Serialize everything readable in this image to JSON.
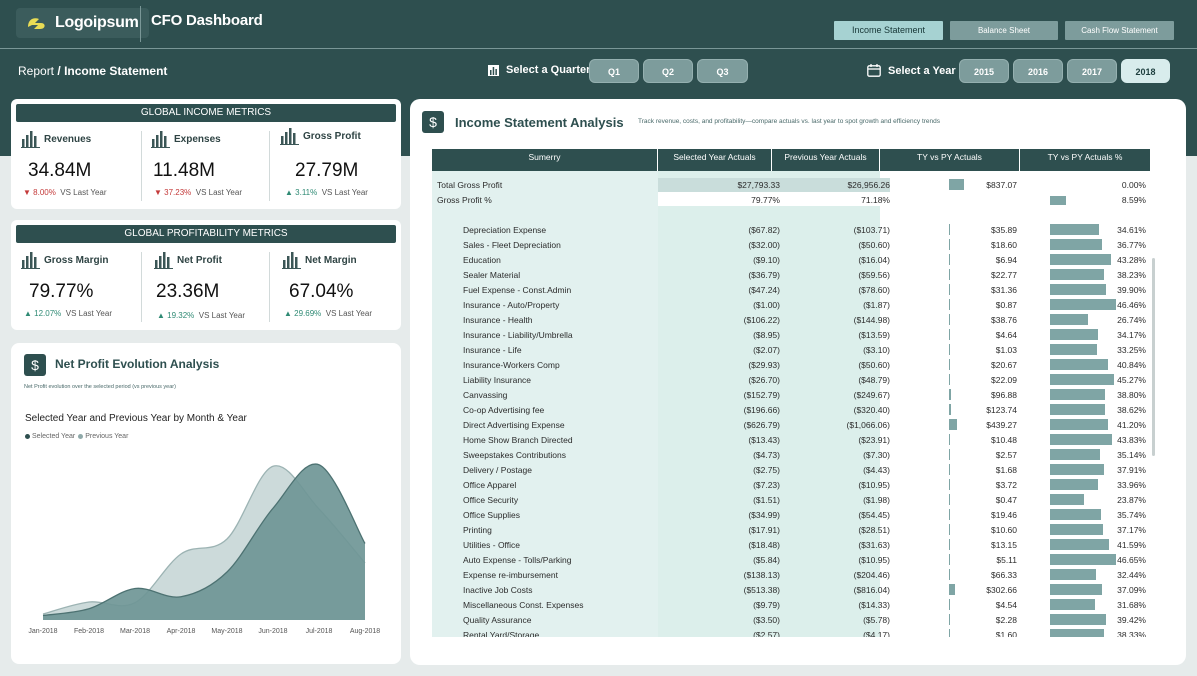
{
  "app": {
    "logo_text": "Logoipsum",
    "title": "CFO Dashboard"
  },
  "nav_tabs": [
    {
      "label": "Income Statement",
      "active": true
    },
    {
      "label": "Balance Sheet",
      "active": false
    },
    {
      "label": "Cash Flow Statement",
      "active": false
    }
  ],
  "breadcrumb": {
    "root": "Report",
    "separator": "/",
    "current": "Income Statement"
  },
  "quarter_filter": {
    "label": "Select a Quarter",
    "options": [
      "Q1",
      "Q2",
      "Q3"
    ]
  },
  "year_filter": {
    "label": "Select a Year",
    "options": [
      "2015",
      "2016",
      "2017",
      "2018"
    ],
    "selected": "2018"
  },
  "income_metrics": {
    "title": "GLOBAL INCOME METRICS",
    "items": [
      {
        "name": "Revenues",
        "value": "34.84M",
        "direction": "down",
        "delta": "8.00%",
        "compare": "VS Last Year"
      },
      {
        "name": "Expenses",
        "value": "11.48M",
        "direction": "down",
        "delta": "37.23%",
        "compare": "VS Last Year"
      },
      {
        "name": "Gross Profit",
        "value": "27.79M",
        "direction": "up",
        "delta": "3.11%",
        "compare": "VS Last Year"
      }
    ]
  },
  "profit_metrics": {
    "title": "GLOBAL PROFITABILITY METRICS",
    "items": [
      {
        "name": "Gross Margin",
        "value": "79.77%",
        "direction": "up",
        "delta": "12.07%",
        "compare": "VS Last Year"
      },
      {
        "name": "Net Profit",
        "value": "23.36M",
        "direction": "up",
        "delta": "19.32%",
        "compare": "VS Last Year"
      },
      {
        "name": "Net Margin",
        "value": "67.04%",
        "direction": "up",
        "delta": "29.69%",
        "compare": "VS Last Year"
      }
    ]
  },
  "net_profit": {
    "badge": "$",
    "title": "Net Profit Evolution Analysis",
    "subtitle": "Net Profit evolution over the selected period (vs previous year)",
    "chart_title": "Selected Year and Previous Year by Month & Year",
    "legend": [
      {
        "name": "Selected Year",
        "color": "#6f9696"
      },
      {
        "name": "Previous Year",
        "color": "#a5bcbc"
      }
    ]
  },
  "chart_data": {
    "type": "area",
    "title": "Selected Year and Previous Year by Month & Year",
    "categories": [
      "Jan-2018",
      "Feb-2018",
      "Mar-2018",
      "Apr-2018",
      "May-2018",
      "Jun-2018",
      "Jul-2018",
      "Aug-2018"
    ],
    "series": [
      {
        "name": "Selected Year",
        "values": [
          0.6,
          1.5,
          4.2,
          3.1,
          6.4,
          14.9,
          20.7,
          10.2
        ],
        "color": "#6f9696"
      },
      {
        "name": "Previous Year",
        "values": [
          0.8,
          2.4,
          2.3,
          8.8,
          10.8,
          20.5,
          14.8,
          7.6
        ],
        "color": "#b9cccc"
      }
    ],
    "ylim": [
      0,
      24
    ],
    "grid": false,
    "legend_position": "top-left"
  },
  "income_statement": {
    "badge": "$",
    "title": "Income Statement Analysis",
    "subtitle": "Track revenue, costs, and profitability—compare actuals vs. last year to spot growth and efficiency trends",
    "columns": [
      "Sumerry",
      "Selected Year Actuals",
      "Previous Year Actuals",
      "TY vs PY Actuals",
      "TY vs PY Actuals %"
    ],
    "summary_rows": [
      {
        "label": "Total Gross Profit",
        "ty": "$27,793.33",
        "py": "$26,956.26",
        "diff": "$837.07",
        "pct": "0.00%",
        "diff_val": 837.07,
        "pct_val": 0.0
      },
      {
        "label": "Gross Profit %",
        "ty": "79.77%",
        "py": "71.18%",
        "diff": "",
        "pct": "8.59%",
        "diff_val": 0,
        "pct_val": 8.59
      }
    ],
    "rows": [
      {
        "label": "Depreciation Expense",
        "ty": "($67.82)",
        "py": "($103.71)",
        "diff": "$35.89",
        "pct": "34.61%",
        "diff_val": 35.89,
        "pct_val": 34.61
      },
      {
        "label": "Sales - Fleet Depreciation",
        "ty": "($32.00)",
        "py": "($50.60)",
        "diff": "$18.60",
        "pct": "36.77%",
        "diff_val": 18.6,
        "pct_val": 36.77
      },
      {
        "label": "Education",
        "ty": "($9.10)",
        "py": "($16.04)",
        "diff": "$6.94",
        "pct": "43.28%",
        "diff_val": 6.94,
        "pct_val": 43.28
      },
      {
        "label": "Sealer Material",
        "ty": "($36.79)",
        "py": "($59.56)",
        "diff": "$22.77",
        "pct": "38.23%",
        "diff_val": 22.77,
        "pct_val": 38.23
      },
      {
        "label": "Fuel Expense - Const.Admin",
        "ty": "($47.24)",
        "py": "($78.60)",
        "diff": "$31.36",
        "pct": "39.90%",
        "diff_val": 31.36,
        "pct_val": 39.9
      },
      {
        "label": "Insurance - Auto/Property",
        "ty": "($1.00)",
        "py": "($1.87)",
        "diff": "$0.87",
        "pct": "46.46%",
        "diff_val": 0.87,
        "pct_val": 46.46
      },
      {
        "label": "Insurance - Health",
        "ty": "($106.22)",
        "py": "($144.98)",
        "diff": "$38.76",
        "pct": "26.74%",
        "diff_val": 38.76,
        "pct_val": 26.74
      },
      {
        "label": "Insurance - Liability/Umbrella",
        "ty": "($8.95)",
        "py": "($13.59)",
        "diff": "$4.64",
        "pct": "34.17%",
        "diff_val": 4.64,
        "pct_val": 34.17
      },
      {
        "label": "Insurance - Life",
        "ty": "($2.07)",
        "py": "($3.10)",
        "diff": "$1.03",
        "pct": "33.25%",
        "diff_val": 1.03,
        "pct_val": 33.25
      },
      {
        "label": "Insurance-Workers Comp",
        "ty": "($29.93)",
        "py": "($50.60)",
        "diff": "$20.67",
        "pct": "40.84%",
        "diff_val": 20.67,
        "pct_val": 40.84
      },
      {
        "label": "Liability Insurance",
        "ty": "($26.70)",
        "py": "($48.79)",
        "diff": "$22.09",
        "pct": "45.27%",
        "diff_val": 22.09,
        "pct_val": 45.27
      },
      {
        "label": "Canvassing",
        "ty": "($152.79)",
        "py": "($249.67)",
        "diff": "$96.88",
        "pct": "38.80%",
        "diff_val": 96.88,
        "pct_val": 38.8
      },
      {
        "label": "Co-op Advertising fee",
        "ty": "($196.66)",
        "py": "($320.40)",
        "diff": "$123.74",
        "pct": "38.62%",
        "diff_val": 123.74,
        "pct_val": 38.62
      },
      {
        "label": "Direct Advertising Expense",
        "ty": "($626.79)",
        "py": "($1,066.06)",
        "diff": "$439.27",
        "pct": "41.20%",
        "diff_val": 439.27,
        "pct_val": 41.2
      },
      {
        "label": "Home Show Branch Directed",
        "ty": "($13.43)",
        "py": "($23.91)",
        "diff": "$10.48",
        "pct": "43.83%",
        "diff_val": 10.48,
        "pct_val": 43.83
      },
      {
        "label": "Sweepstakes Contributions",
        "ty": "($4.73)",
        "py": "($7.30)",
        "diff": "$2.57",
        "pct": "35.14%",
        "diff_val": 2.57,
        "pct_val": 35.14
      },
      {
        "label": "Delivery / Postage",
        "ty": "($2.75)",
        "py": "($4.43)",
        "diff": "$1.68",
        "pct": "37.91%",
        "diff_val": 1.68,
        "pct_val": 37.91
      },
      {
        "label": "Office Apparel",
        "ty": "($7.23)",
        "py": "($10.95)",
        "diff": "$3.72",
        "pct": "33.96%",
        "diff_val": 3.72,
        "pct_val": 33.96
      },
      {
        "label": "Office Security",
        "ty": "($1.51)",
        "py": "($1.98)",
        "diff": "$0.47",
        "pct": "23.87%",
        "diff_val": 0.47,
        "pct_val": 23.87
      },
      {
        "label": "Office Supplies",
        "ty": "($34.99)",
        "py": "($54.45)",
        "diff": "$19.46",
        "pct": "35.74%",
        "diff_val": 19.46,
        "pct_val": 35.74
      },
      {
        "label": "Printing",
        "ty": "($17.91)",
        "py": "($28.51)",
        "diff": "$10.60",
        "pct": "37.17%",
        "diff_val": 10.6,
        "pct_val": 37.17
      },
      {
        "label": "Utilities - Office",
        "ty": "($18.48)",
        "py": "($31.63)",
        "diff": "$13.15",
        "pct": "41.59%",
        "diff_val": 13.15,
        "pct_val": 41.59
      },
      {
        "label": "Auto Expense - Tolls/Parking",
        "ty": "($5.84)",
        "py": "($10.95)",
        "diff": "$5.11",
        "pct": "46.65%",
        "diff_val": 5.11,
        "pct_val": 46.65
      },
      {
        "label": "Expense re-imbursement",
        "ty": "($138.13)",
        "py": "($204.46)",
        "diff": "$66.33",
        "pct": "32.44%",
        "diff_val": 66.33,
        "pct_val": 32.44
      },
      {
        "label": "Inactive Job Costs",
        "ty": "($513.38)",
        "py": "($816.04)",
        "diff": "$302.66",
        "pct": "37.09%",
        "diff_val": 302.66,
        "pct_val": 37.09
      },
      {
        "label": "Miscellaneous Const. Expenses",
        "ty": "($9.79)",
        "py": "($14.33)",
        "diff": "$4.54",
        "pct": "31.68%",
        "diff_val": 4.54,
        "pct_val": 31.68
      },
      {
        "label": "Quality Assurance",
        "ty": "($3.50)",
        "py": "($5.78)",
        "diff": "$2.28",
        "pct": "39.42%",
        "diff_val": 2.28,
        "pct_val": 39.42
      },
      {
        "label": "Rental Yard/Storage",
        "ty": "($2.57)",
        "py": "($4.17)",
        "diff": "$1.60",
        "pct": "38.33%",
        "diff_val": 1.6,
        "pct_val": 38.33
      }
    ]
  },
  "colors": {
    "brand_dark": "#2e4f4f",
    "accent": "#a6d2d2",
    "bar": "#7fa5a5",
    "up": "#2f8a74",
    "down": "#c43a3a"
  }
}
